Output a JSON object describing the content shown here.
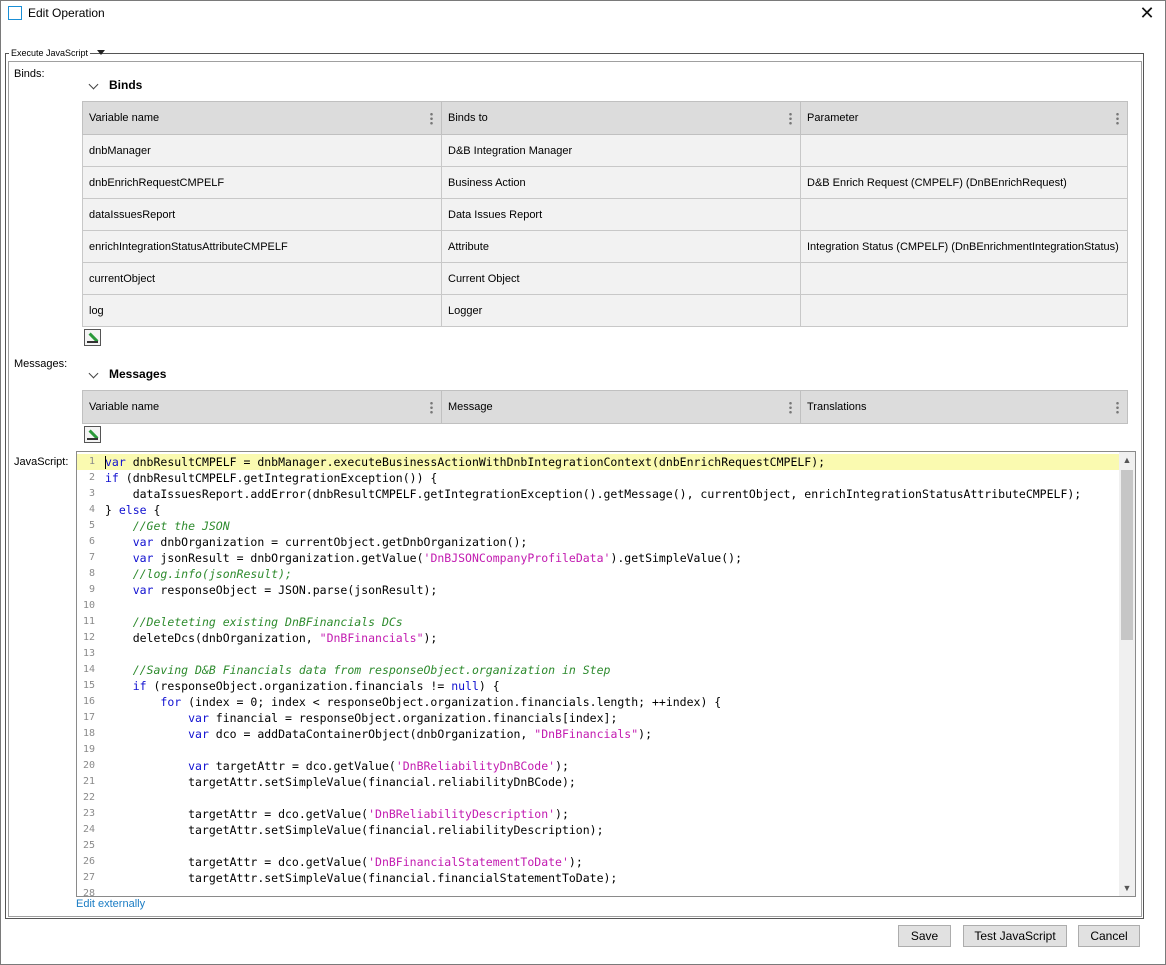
{
  "window": {
    "title": "Edit Operation",
    "close_glyph": "✕"
  },
  "group": {
    "label": "Execute JavaScript"
  },
  "labels": {
    "binds": "Binds:",
    "messages": "Messages:",
    "javascript": "JavaScript:"
  },
  "binds": {
    "section_title": "Binds",
    "columns": [
      "Variable name",
      "Binds to",
      "Parameter"
    ],
    "rows": [
      [
        "dnbManager",
        "D&B Integration Manager",
        ""
      ],
      [
        "dnbEnrichRequestCMPELF",
        "Business Action",
        "D&B Enrich Request (CMPELF) (DnBEnrichRequest)"
      ],
      [
        "dataIssuesReport",
        "Data Issues Report",
        ""
      ],
      [
        "enrichIntegrationStatusAttributeCMPELF",
        "Attribute",
        "Integration Status (CMPELF) (DnBEnrichmentIntegrationStatus)"
      ],
      [
        "currentObject",
        "Current Object",
        ""
      ],
      [
        "log",
        "Logger",
        ""
      ]
    ]
  },
  "messages": {
    "section_title": "Messages",
    "columns": [
      "Variable name",
      "Message",
      "Translations"
    ]
  },
  "code": {
    "lines": [
      "var dnbResultCMPELF = dnbManager.executeBusinessActionWithDnbIntegrationContext(dnbEnrichRequestCMPELF);",
      "if (dnbResultCMPELF.getIntegrationException()) {",
      "    dataIssuesReport.addError(dnbResultCMPELF.getIntegrationException().getMessage(), currentObject, enrichIntegrationStatusAttributeCMPELF);",
      "} else {",
      "    //Get the JSON",
      "    var dnbOrganization = currentObject.getDnbOrganization();",
      "    var jsonResult = dnbOrganization.getValue('DnBJSONCompanyProfileData').getSimpleValue();",
      "    //log.info(jsonResult);",
      "    var responseObject = JSON.parse(jsonResult);",
      "",
      "    //Deleteting existing DnBFinancials DCs",
      "    deleteDcs(dnbOrganization, \"DnBFinancials\");",
      "",
      "    //Saving D&B Financials data from responseObject.organization in Step",
      "    if (responseObject.organization.financials != null) {",
      "        for (index = 0; index < responseObject.organization.financials.length; ++index) {",
      "            var financial = responseObject.organization.financials[index];",
      "            var dco = addDataContainerObject(dnbOrganization, \"DnBFinancials\");",
      "",
      "            var targetAttr = dco.getValue('DnBReliabilityDnBCode');",
      "            targetAttr.setSimpleValue(financial.reliabilityDnBCode);",
      "",
      "            targetAttr = dco.getValue('DnBReliabilityDescription');",
      "            targetAttr.setSimpleValue(financial.reliabilityDescription);",
      "",
      "            targetAttr = dco.getValue('DnBFinancialStatementToDate');",
      "            targetAttr.setSimpleValue(financial.financialStatementToDate);",
      "",
      ""
    ],
    "active_line": 1
  },
  "edit_externally": "Edit externally",
  "buttons": {
    "save": "Save",
    "test": "Test JavaScript",
    "cancel": "Cancel"
  }
}
